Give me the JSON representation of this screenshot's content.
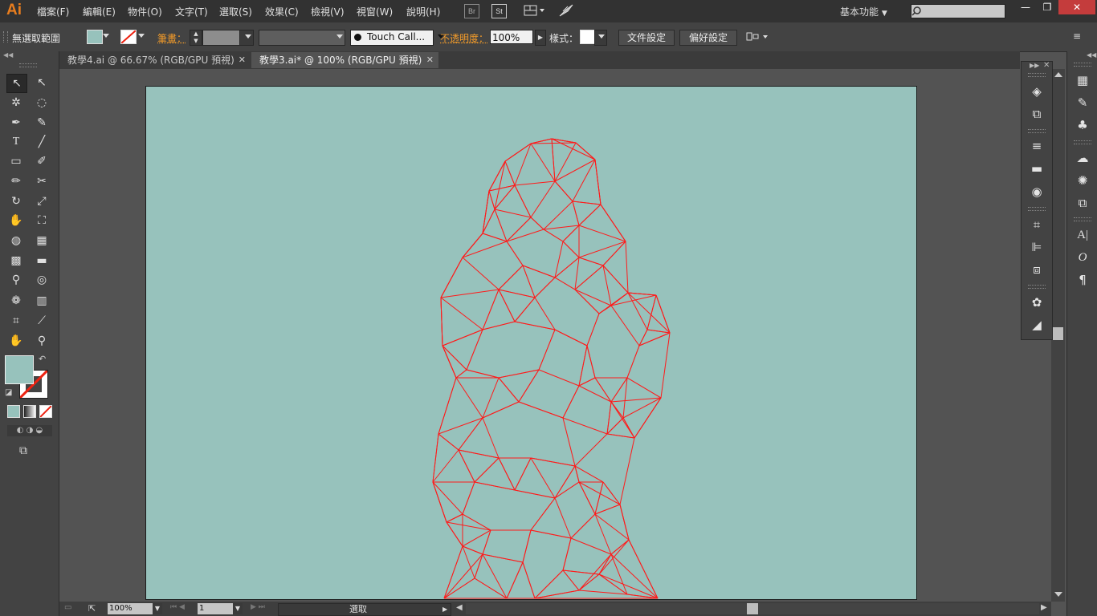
{
  "app": {
    "logo": "Ai"
  },
  "menu": {
    "items": [
      "檔案(F)",
      "編輯(E)",
      "物件(O)",
      "文字(T)",
      "選取(S)",
      "效果(C)",
      "檢視(V)",
      "視窗(W)",
      "說明(H)"
    ],
    "br_label": "Br",
    "st_label": "St",
    "workspace": "基本功能"
  },
  "window_buttons": {
    "minimize": "—",
    "restore": "❐",
    "close": "✕"
  },
  "control": {
    "selection_label": "無選取範圍",
    "stroke_label": "筆畫：",
    "brush_label": "Touch Call...",
    "opacity_label": "不透明度：",
    "opacity_value": "100%",
    "style_label": "樣式：",
    "doc_setup_button": "文件設定",
    "preferences_button": "偏好設定"
  },
  "tabs": [
    {
      "label": "教學4.ai @ 66.67% (RGB/GPU 預視)",
      "active": false
    },
    {
      "label": "教學3.ai* @ 100% (RGB/GPU 預視)",
      "active": true
    }
  ],
  "status": {
    "zoom": "100%",
    "page": "1",
    "tool": "選取"
  },
  "colors": {
    "fill": "#97c2bc",
    "artboard": "#97c2bc",
    "mesh_stroke": "#ff1a1a",
    "accent": "#e87d1e"
  }
}
